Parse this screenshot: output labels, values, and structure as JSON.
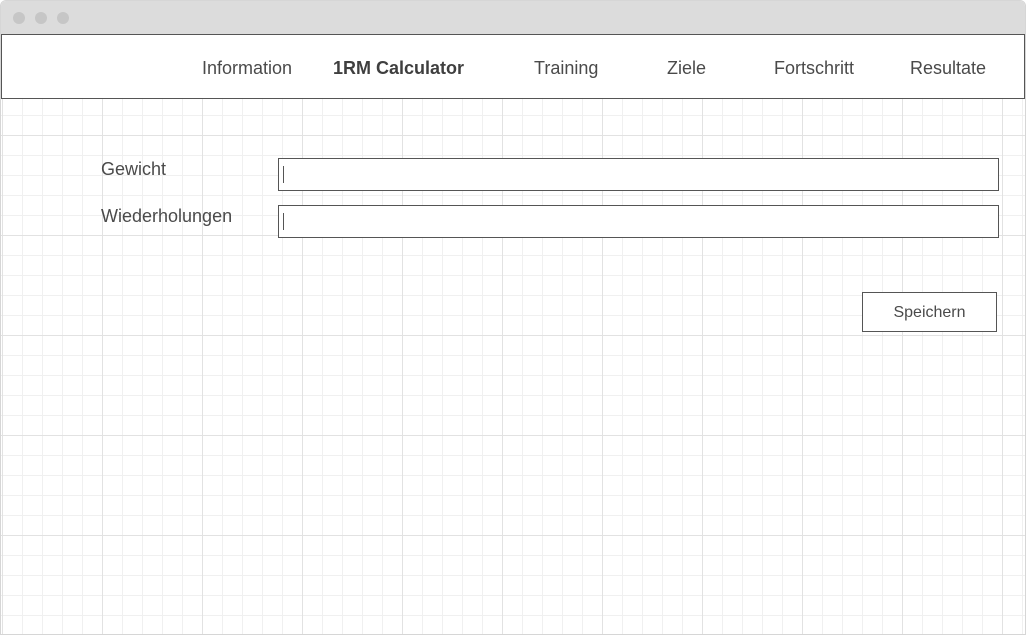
{
  "nav": {
    "items": [
      {
        "label": "Information",
        "active": false
      },
      {
        "label": "1RM Calculator",
        "active": true
      },
      {
        "label": "Training",
        "active": false
      },
      {
        "label": "Ziele",
        "active": false
      },
      {
        "label": "Fortschritt",
        "active": false
      },
      {
        "label": "Resultate",
        "active": false
      }
    ]
  },
  "form": {
    "weight_label": "Gewicht",
    "weight_value": "",
    "reps_label": "Wiederholungen",
    "reps_value": "",
    "save_label": "Speichern"
  },
  "colors": {
    "border": "#555555",
    "text": "#4a4a4a",
    "titlebar": "#dcdcdc",
    "grid_major": "#e2e2e2",
    "grid_minor": "#f0f0f0"
  }
}
